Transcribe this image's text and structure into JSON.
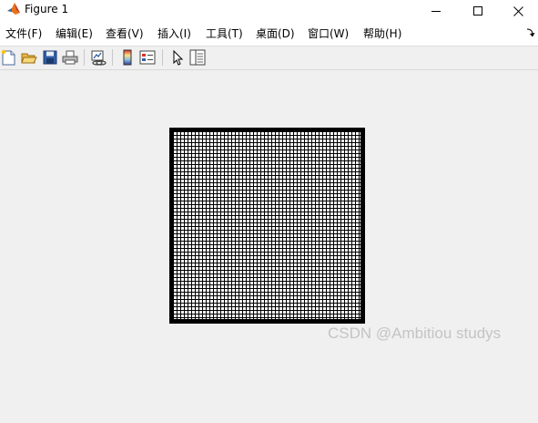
{
  "window": {
    "title": "Figure 1"
  },
  "menu": {
    "items": [
      {
        "label": "文件(F)"
      },
      {
        "label": "编辑(E)"
      },
      {
        "label": "查看(V)"
      },
      {
        "label": "插入(I)"
      },
      {
        "label": "工具(T)"
      },
      {
        "label": "桌面(D)"
      },
      {
        "label": "窗口(W)"
      },
      {
        "label": "帮助(H)"
      }
    ]
  },
  "toolbar": {
    "buttons": [
      {
        "icon": "new-figure-icon"
      },
      {
        "icon": "open-file-icon"
      },
      {
        "icon": "save-icon"
      },
      {
        "icon": "print-icon"
      },
      {
        "icon": "link-plot-icon"
      },
      {
        "icon": "insert-colorbar-icon"
      },
      {
        "icon": "insert-legend-icon"
      },
      {
        "icon": "edit-plot-pointer-icon"
      },
      {
        "icon": "property-inspector-icon"
      }
    ]
  },
  "figure": {
    "content": "binary-grid-image",
    "colors": {
      "foreground": "#ffffff",
      "background": "#000000"
    }
  },
  "watermark": {
    "text": "CSDN @Ambitiou  studys"
  }
}
